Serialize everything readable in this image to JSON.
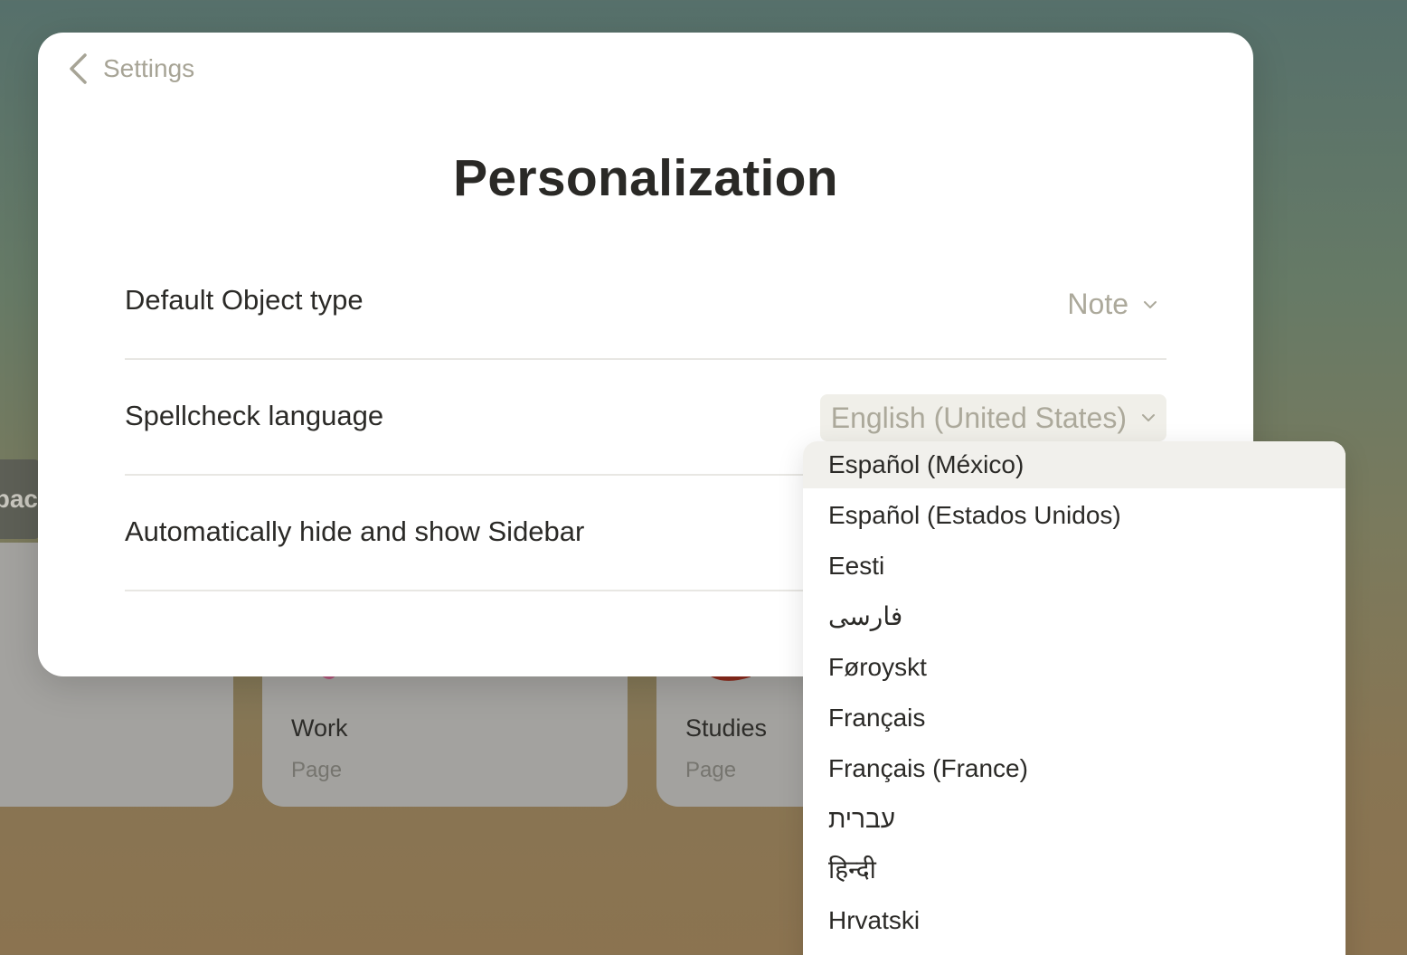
{
  "background": {
    "partial_button_text": "bac",
    "cards": [
      {
        "title": "",
        "subtitle": ""
      },
      {
        "title": "Work",
        "subtitle": "Page"
      },
      {
        "title": "Studies",
        "subtitle": "Page"
      }
    ]
  },
  "modal": {
    "back_label": "Settings",
    "title": "Personalization",
    "rows": [
      {
        "label": "Default Object type",
        "value": "Note"
      },
      {
        "label": "Spellcheck language",
        "value": "English (United States)"
      },
      {
        "label": "Automatically hide and show Sidebar"
      }
    ]
  },
  "dropdown": {
    "options": [
      "Español (México)",
      "Español (Estados Unidos)",
      "Eesti",
      "فارسی",
      "Føroyskt",
      "Français",
      "Français (France)",
      "עברית",
      "हिन्दी",
      "Hrvatski"
    ],
    "highlighted_index": 0
  },
  "colors": {
    "accent_text": "#aca99b",
    "title": "#2a2926",
    "highlight": "#f1f0ec"
  }
}
